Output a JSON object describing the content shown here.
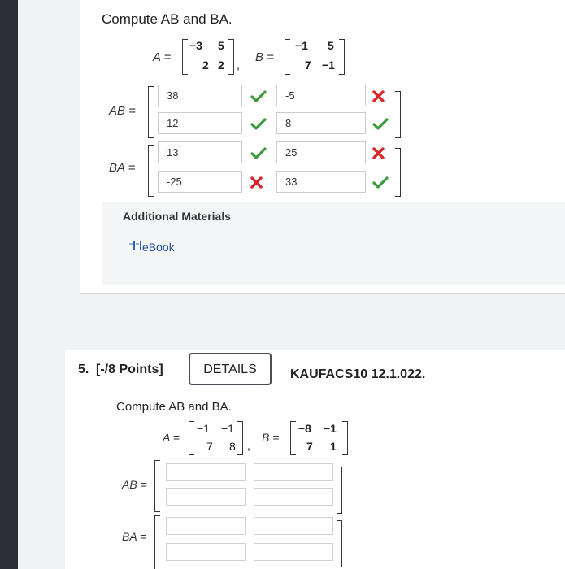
{
  "q4": {
    "prompt": "Compute AB and BA.",
    "a_label": "A =",
    "b_label": "B =",
    "a_matrix": [
      [
        "−3",
        "5"
      ],
      [
        "2",
        "2"
      ]
    ],
    "b_matrix": [
      [
        "−1",
        "5"
      ],
      [
        "7",
        "−1"
      ]
    ],
    "ab_label": "AB =",
    "ba_label": "BA =",
    "ab_answers": [
      [
        "38",
        "-5"
      ],
      [
        "12",
        "8"
      ]
    ],
    "ba_answers": [
      [
        "13",
        "25"
      ],
      [
        "-25",
        "33"
      ]
    ],
    "ab_status": [
      [
        "correct",
        "incorrect"
      ],
      [
        "correct",
        "correct"
      ]
    ],
    "ba_status": [
      [
        "correct",
        "incorrect"
      ],
      [
        "incorrect",
        "correct"
      ]
    ],
    "additional_materials": "Additional Materials",
    "ebook": "eBook"
  },
  "q5": {
    "number": "5.",
    "points": "[-/8 Points]",
    "details_button": "DETAILS",
    "code": "KAUFACS10 12.1.022.",
    "prompt": "Compute AB and BA.",
    "a_label": "A =",
    "b_label": "B =",
    "a_matrix": [
      [
        "−1",
        "−1"
      ],
      [
        "7",
        "8"
      ]
    ],
    "b_matrix": [
      [
        "−8",
        "−1"
      ],
      [
        "7",
        "1"
      ]
    ],
    "ab_label": "AB =",
    "ba_label": "BA ="
  },
  "colors": {
    "correct": "#3c9a3c",
    "incorrect": "#d9262a"
  }
}
